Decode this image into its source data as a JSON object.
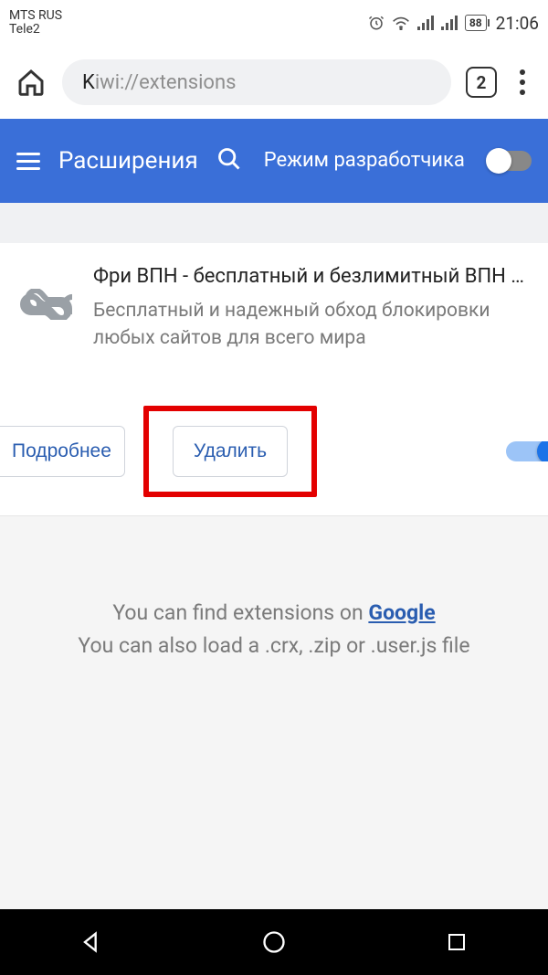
{
  "status": {
    "carrier1": "MTS RUS",
    "carrier2": "Tele2",
    "battery": "88",
    "time": "21:06"
  },
  "browser": {
    "url_display": "kiwi://extensions",
    "tab_count": "2"
  },
  "header": {
    "title": "Расширения",
    "dev_mode_label": "Режим разработчика"
  },
  "extension": {
    "title": "Фри ВПН - бесплатный и безлимитный ВПН …",
    "description": "Бесплатный и надежный обход блокировки любых сайтов для всего мира",
    "details_label": "Подробнее",
    "delete_label": "Удалить"
  },
  "footer": {
    "line1_before": "You can find extensions on ",
    "link": "Google",
    "line2": "You can also load a .crx, .zip or .user.js file"
  }
}
